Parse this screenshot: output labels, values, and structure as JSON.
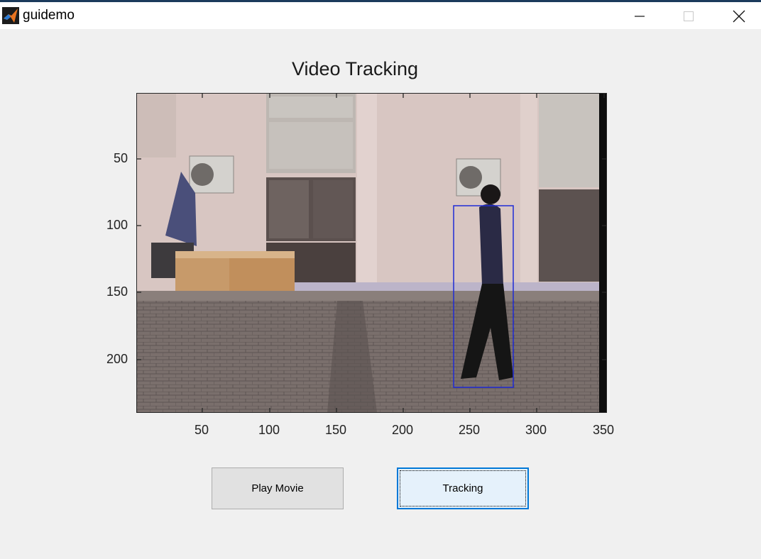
{
  "window": {
    "title": "guidemo",
    "app_icon": "matlab-logo-icon",
    "controls": [
      "minimize-icon",
      "maximize-icon",
      "close-icon"
    ]
  },
  "axes": {
    "title": "Video Tracking",
    "x_ticks": [
      "50",
      "100",
      "150",
      "200",
      "250",
      "300",
      "350"
    ],
    "y_ticks": [
      "50",
      "100",
      "150",
      "200"
    ],
    "tracking_box_color": "#1f2bd6"
  },
  "buttons": {
    "play_movie": "Play Movie",
    "tracking": "Tracking"
  },
  "colors": {
    "background": "#f0f0f0",
    "focus_border": "#0078d7",
    "button_face": "#e1e1e1"
  }
}
